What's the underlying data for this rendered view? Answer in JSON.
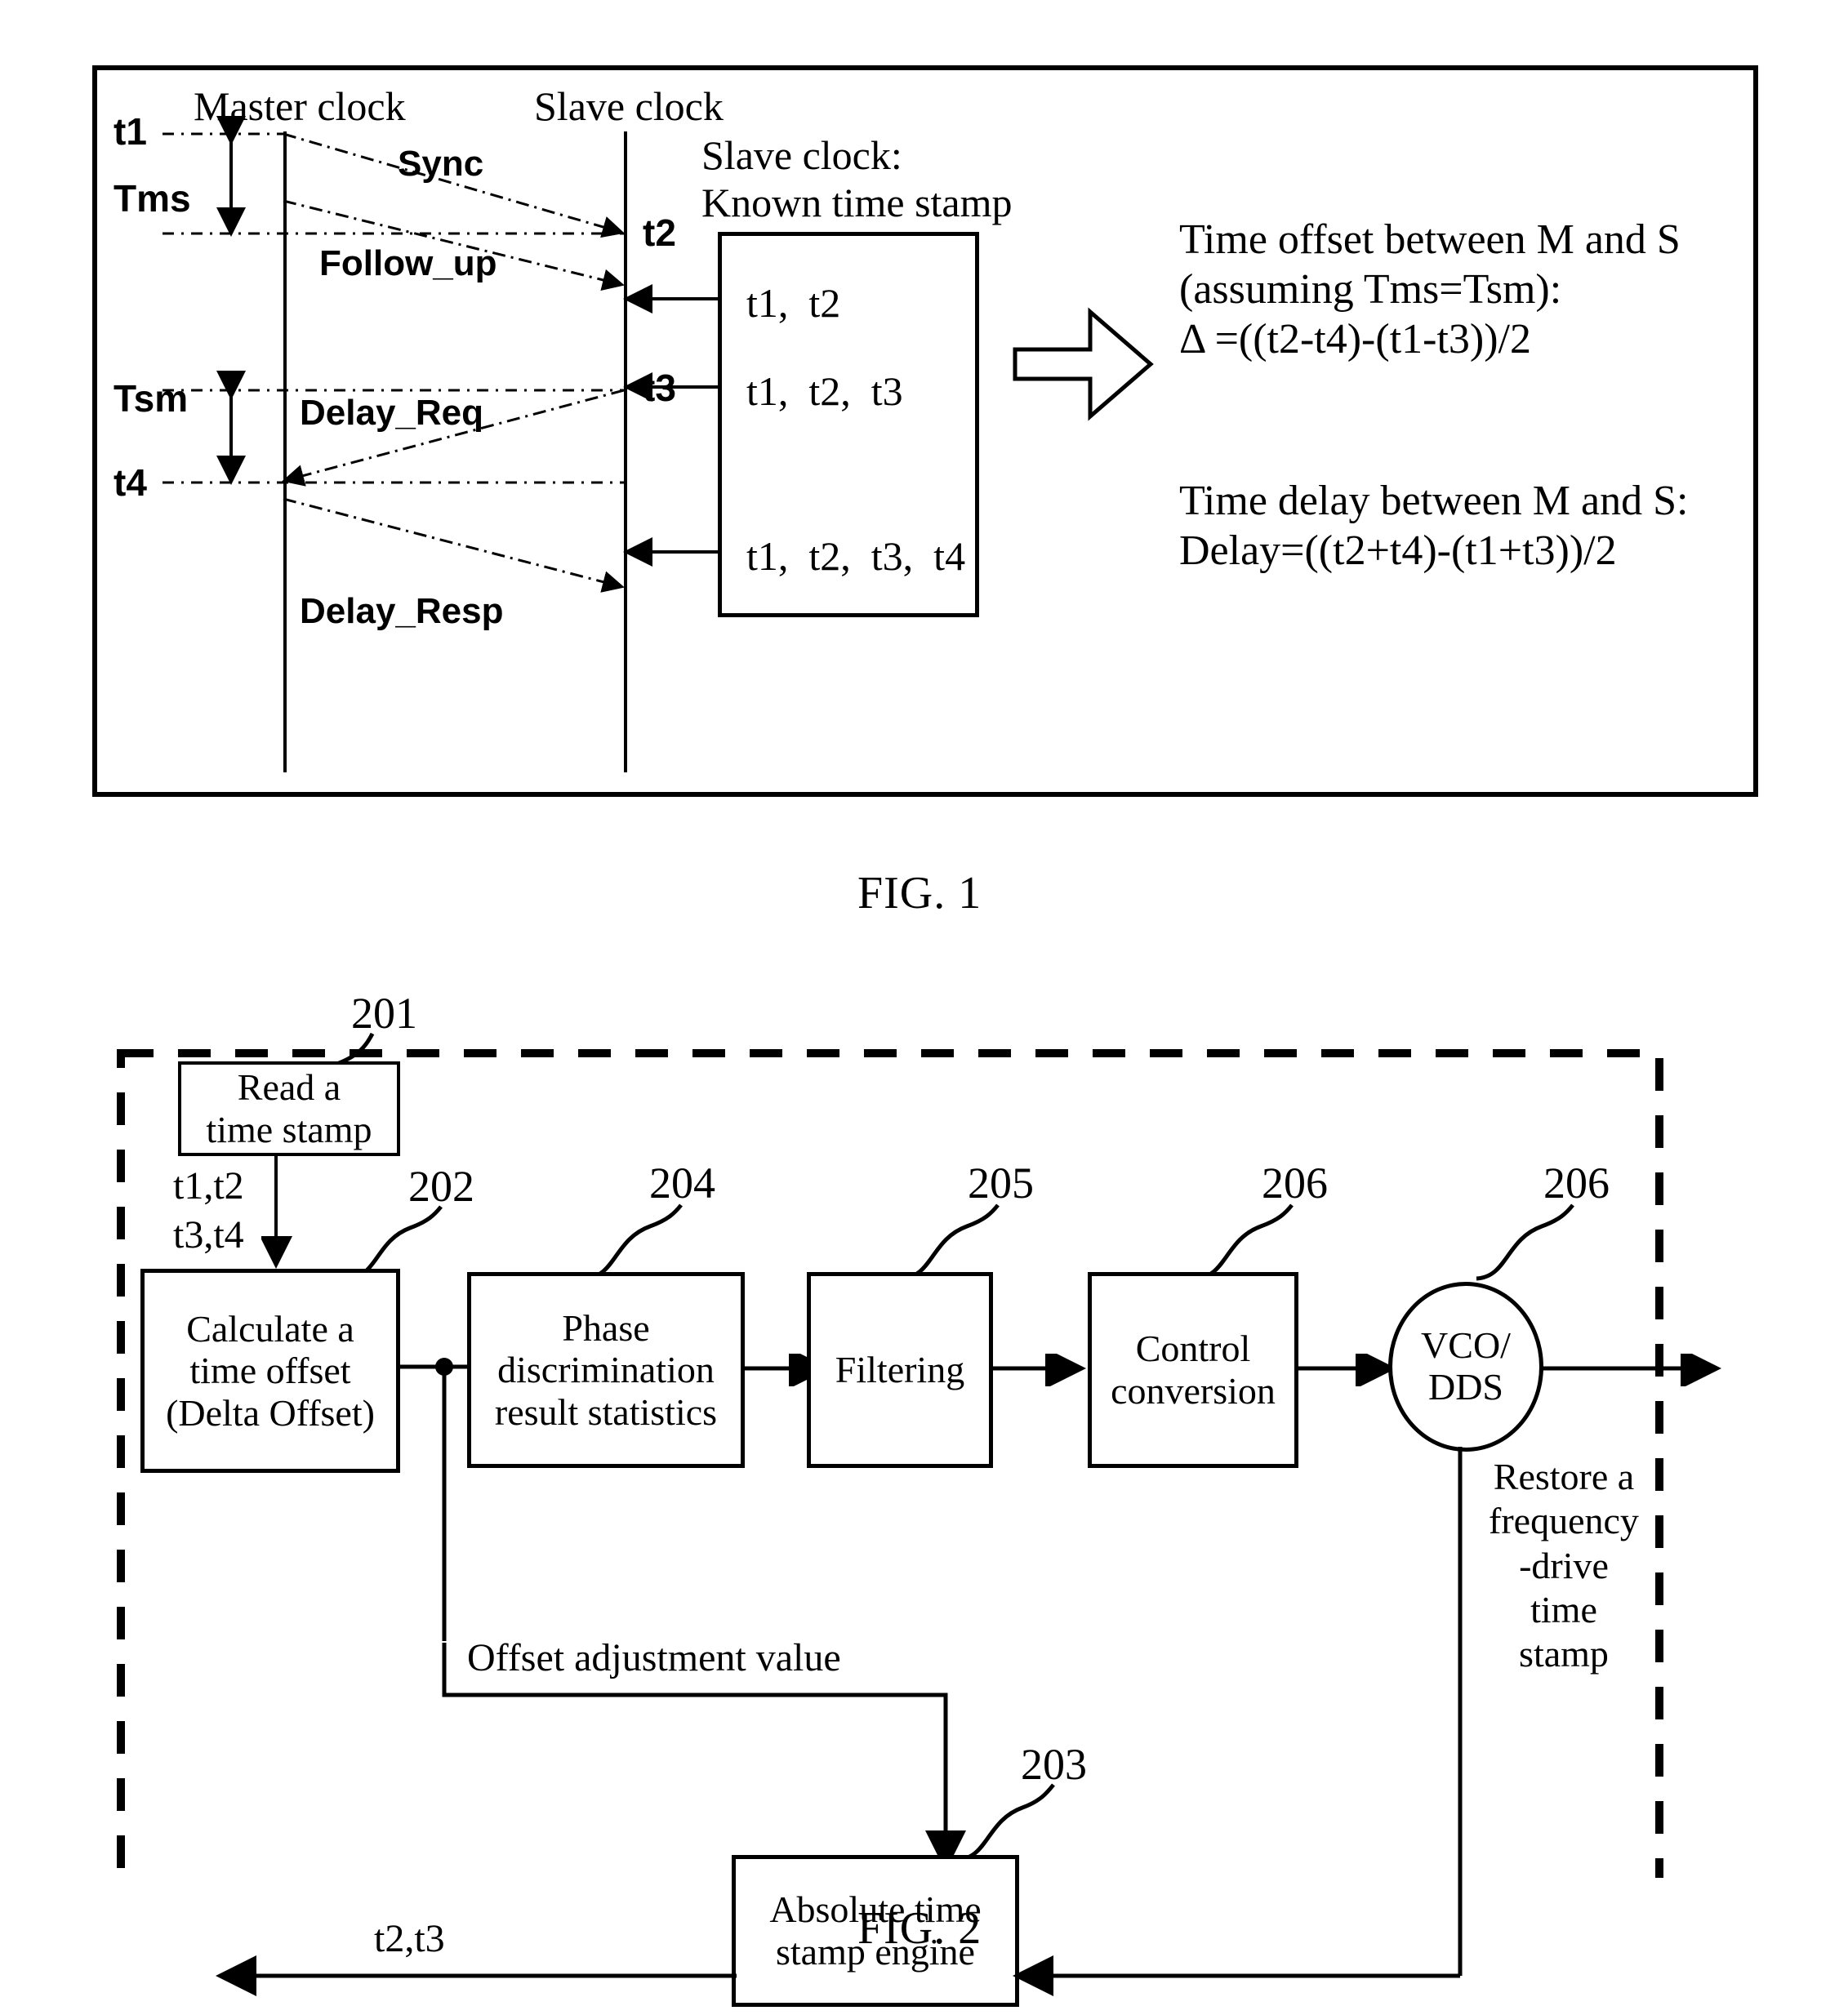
{
  "figure1": {
    "caption": "FIG. 1",
    "axis_labels": {
      "master": "Master clock",
      "slave": "Slave clock"
    },
    "time_ticks": {
      "t1": "t1",
      "t2": "t2",
      "t3": "t3",
      "t4": "t4"
    },
    "intervals": {
      "tms": "Tms",
      "tsm": "Tsm"
    },
    "messages": {
      "sync": "Sync",
      "follow_up": "Follow_up",
      "delay_req": "Delay_Req",
      "delay_resp": "Delay_Resp"
    },
    "timestamp_box": {
      "title_line1": "Slave clock:",
      "title_line2": "Known time stamp",
      "rows": [
        "t1,  t2",
        "t1,  t2,  t3",
        "t1,  t2,  t3,  t4"
      ]
    },
    "result_text": {
      "offset": "Time offset between M and S (assuming Tms=Tsm):\nΔ =((t2-t4)-(t1-t3))/2",
      "delay": "Time  delay  between  M and S:\nDelay=((t2+t4)-(t1+t3))/2"
    }
  },
  "figure2": {
    "caption": "FIG. 2",
    "blocks": {
      "read_time_stamp": "Read a\ntime stamp",
      "calculate_offset": "Calculate a\ntime offset\n(Delta Offset)",
      "phase_statistics": "Phase\ndiscrimination\nresult statistics",
      "filtering": "Filtering",
      "control_conversion": "Control\nconversion",
      "vco_dds": "VCO/\nDDS",
      "absolute_engine": "Absolute time\nstamp engine"
    },
    "ref_numbers": {
      "read": "201",
      "calculate": "202",
      "absolute": "203",
      "phase": "204",
      "filtering": "205",
      "control": "206",
      "vco": "206"
    },
    "signals": {
      "input_ts_line1": "t1,t2",
      "input_ts_line2": "t3,t4",
      "offset_adjustment": "Offset adjustment value",
      "restore_frequency": "Restore a\nfrequency\n-drive\ntime\nstamp",
      "feedback_ts": "t2,t3"
    }
  },
  "colors": {
    "ink": "#000000",
    "paper": "#ffffff"
  }
}
